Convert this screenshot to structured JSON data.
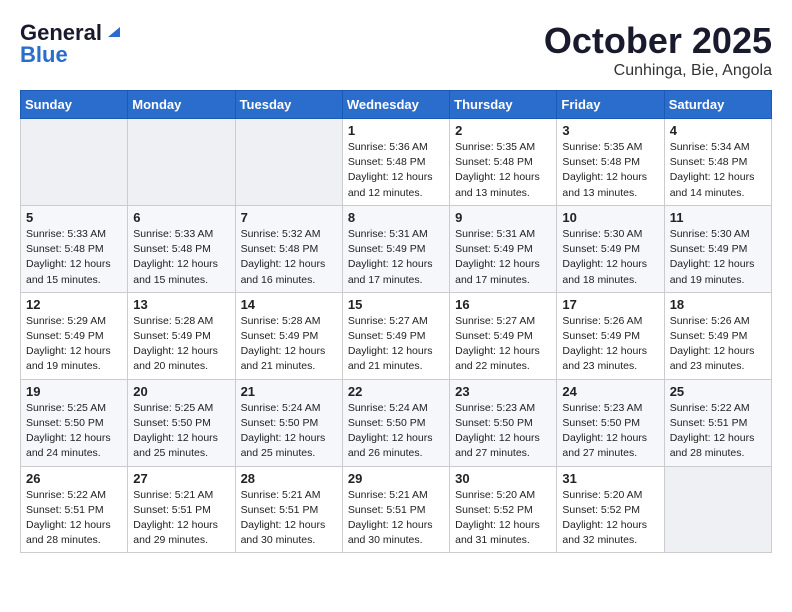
{
  "header": {
    "logo_line1": "General",
    "logo_line2": "Blue",
    "title": "October 2025",
    "subtitle": "Cunhinga, Bie, Angola"
  },
  "calendar": {
    "days_of_week": [
      "Sunday",
      "Monday",
      "Tuesday",
      "Wednesday",
      "Thursday",
      "Friday",
      "Saturday"
    ],
    "weeks": [
      [
        {
          "day": "",
          "info": ""
        },
        {
          "day": "",
          "info": ""
        },
        {
          "day": "",
          "info": ""
        },
        {
          "day": "1",
          "info": "Sunrise: 5:36 AM\nSunset: 5:48 PM\nDaylight: 12 hours\nand 12 minutes."
        },
        {
          "day": "2",
          "info": "Sunrise: 5:35 AM\nSunset: 5:48 PM\nDaylight: 12 hours\nand 13 minutes."
        },
        {
          "day": "3",
          "info": "Sunrise: 5:35 AM\nSunset: 5:48 PM\nDaylight: 12 hours\nand 13 minutes."
        },
        {
          "day": "4",
          "info": "Sunrise: 5:34 AM\nSunset: 5:48 PM\nDaylight: 12 hours\nand 14 minutes."
        }
      ],
      [
        {
          "day": "5",
          "info": "Sunrise: 5:33 AM\nSunset: 5:48 PM\nDaylight: 12 hours\nand 15 minutes."
        },
        {
          "day": "6",
          "info": "Sunrise: 5:33 AM\nSunset: 5:48 PM\nDaylight: 12 hours\nand 15 minutes."
        },
        {
          "day": "7",
          "info": "Sunrise: 5:32 AM\nSunset: 5:48 PM\nDaylight: 12 hours\nand 16 minutes."
        },
        {
          "day": "8",
          "info": "Sunrise: 5:31 AM\nSunset: 5:49 PM\nDaylight: 12 hours\nand 17 minutes."
        },
        {
          "day": "9",
          "info": "Sunrise: 5:31 AM\nSunset: 5:49 PM\nDaylight: 12 hours\nand 17 minutes."
        },
        {
          "day": "10",
          "info": "Sunrise: 5:30 AM\nSunset: 5:49 PM\nDaylight: 12 hours\nand 18 minutes."
        },
        {
          "day": "11",
          "info": "Sunrise: 5:30 AM\nSunset: 5:49 PM\nDaylight: 12 hours\nand 19 minutes."
        }
      ],
      [
        {
          "day": "12",
          "info": "Sunrise: 5:29 AM\nSunset: 5:49 PM\nDaylight: 12 hours\nand 19 minutes."
        },
        {
          "day": "13",
          "info": "Sunrise: 5:28 AM\nSunset: 5:49 PM\nDaylight: 12 hours\nand 20 minutes."
        },
        {
          "day": "14",
          "info": "Sunrise: 5:28 AM\nSunset: 5:49 PM\nDaylight: 12 hours\nand 21 minutes."
        },
        {
          "day": "15",
          "info": "Sunrise: 5:27 AM\nSunset: 5:49 PM\nDaylight: 12 hours\nand 21 minutes."
        },
        {
          "day": "16",
          "info": "Sunrise: 5:27 AM\nSunset: 5:49 PM\nDaylight: 12 hours\nand 22 minutes."
        },
        {
          "day": "17",
          "info": "Sunrise: 5:26 AM\nSunset: 5:49 PM\nDaylight: 12 hours\nand 23 minutes."
        },
        {
          "day": "18",
          "info": "Sunrise: 5:26 AM\nSunset: 5:49 PM\nDaylight: 12 hours\nand 23 minutes."
        }
      ],
      [
        {
          "day": "19",
          "info": "Sunrise: 5:25 AM\nSunset: 5:50 PM\nDaylight: 12 hours\nand 24 minutes."
        },
        {
          "day": "20",
          "info": "Sunrise: 5:25 AM\nSunset: 5:50 PM\nDaylight: 12 hours\nand 25 minutes."
        },
        {
          "day": "21",
          "info": "Sunrise: 5:24 AM\nSunset: 5:50 PM\nDaylight: 12 hours\nand 25 minutes."
        },
        {
          "day": "22",
          "info": "Sunrise: 5:24 AM\nSunset: 5:50 PM\nDaylight: 12 hours\nand 26 minutes."
        },
        {
          "day": "23",
          "info": "Sunrise: 5:23 AM\nSunset: 5:50 PM\nDaylight: 12 hours\nand 27 minutes."
        },
        {
          "day": "24",
          "info": "Sunrise: 5:23 AM\nSunset: 5:50 PM\nDaylight: 12 hours\nand 27 minutes."
        },
        {
          "day": "25",
          "info": "Sunrise: 5:22 AM\nSunset: 5:51 PM\nDaylight: 12 hours\nand 28 minutes."
        }
      ],
      [
        {
          "day": "26",
          "info": "Sunrise: 5:22 AM\nSunset: 5:51 PM\nDaylight: 12 hours\nand 28 minutes."
        },
        {
          "day": "27",
          "info": "Sunrise: 5:21 AM\nSunset: 5:51 PM\nDaylight: 12 hours\nand 29 minutes."
        },
        {
          "day": "28",
          "info": "Sunrise: 5:21 AM\nSunset: 5:51 PM\nDaylight: 12 hours\nand 30 minutes."
        },
        {
          "day": "29",
          "info": "Sunrise: 5:21 AM\nSunset: 5:51 PM\nDaylight: 12 hours\nand 30 minutes."
        },
        {
          "day": "30",
          "info": "Sunrise: 5:20 AM\nSunset: 5:52 PM\nDaylight: 12 hours\nand 31 minutes."
        },
        {
          "day": "31",
          "info": "Sunrise: 5:20 AM\nSunset: 5:52 PM\nDaylight: 12 hours\nand 32 minutes."
        },
        {
          "day": "",
          "info": ""
        }
      ]
    ]
  }
}
